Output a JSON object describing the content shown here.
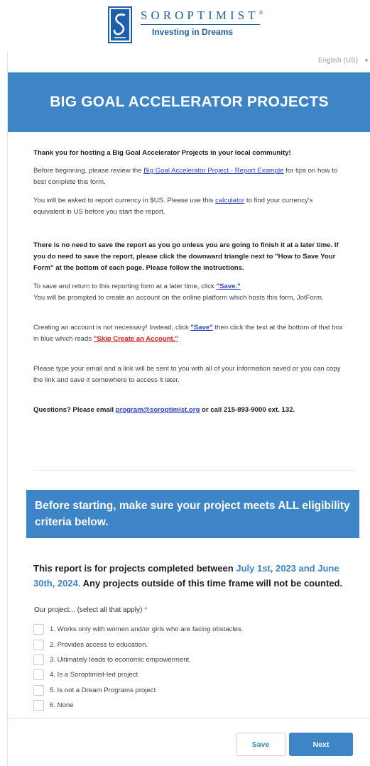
{
  "logo": {
    "wordmark": "SOROPTIMIST",
    "registered": "®",
    "tagline": "Investing in Dreams"
  },
  "language": {
    "selected": "English (US)",
    "icon": "chevron-down-icon"
  },
  "header": {
    "title": "BIG GOAL ACCELERATOR PROJECTS"
  },
  "intro": {
    "thanks": "Thank you for hosting a Big Goal Accelerator Projects in your local community!",
    "review_pre": "Before beginning, please review the ",
    "review_link": "Big Goal Accelerator Project - Report Example",
    "review_post": " for tips on how to best complete this form.",
    "currency_pre": "You will be asked to report currency in $US. Please use this ",
    "currency_link": "calculator",
    "currency_post": " to find your currency's equivalent in US before you start the report.",
    "no_save": "There is no need to save the report as you go unless you are going to finish it at a later time. If you do need to save the report, please click the downward triangle next to \"How to Save Your Form\" at the bottom of each page. Please follow the instructions.",
    "save_pre": "To save and return to this reporting form at a later time, click ",
    "save_link": "\"Save.\"",
    "prompted": "You will be prompted to create an account on the online platform which hosts this form, JotForm.",
    "account_pre": "Creating an account is not necessary! Instead, click ",
    "account_save_link": "\"Save\"",
    "account_mid": " then click the text at the bottom of that box in blue which reads ",
    "account_skip_link": "\"Skip Create an Account.\"",
    "email_note": "Please type your email and a link will be sent to you with all of your information saved or you can copy the link and save it somewhere to access it later.",
    "questions_pre": "Questions? Please email ",
    "questions_email": "program@soroptimist.org",
    "questions_post": " or call 215-893-9000 ext. 132."
  },
  "criteria": {
    "banner": "Before starting, make sure your project meets ALL eligibility criteria below.",
    "period_pre": "This report is for projects completed between ",
    "period_dates": "July 1st, 2023 and June 30th, 2024.",
    "period_post": " Any projects outside of this time frame will not be counted.",
    "question": "Our project... (select all that apply)",
    "required_mark": "*",
    "options": [
      "1. Works only with women and/or girls who are facing obstacles.",
      "2. Provides access to education.",
      "3. Ultimately leads to economic empowerment.",
      "4. Is a Soroptimist-led project",
      "5. Is not a Dream Programs project",
      "6. None"
    ]
  },
  "footer": {
    "save_label": "Save",
    "next_label": "Next"
  },
  "colors": {
    "brand": "#1f5fa8",
    "accent": "#3d85c6",
    "required": "#f23a3c",
    "link": "#2d44c9",
    "link_red": "#c8231f"
  }
}
